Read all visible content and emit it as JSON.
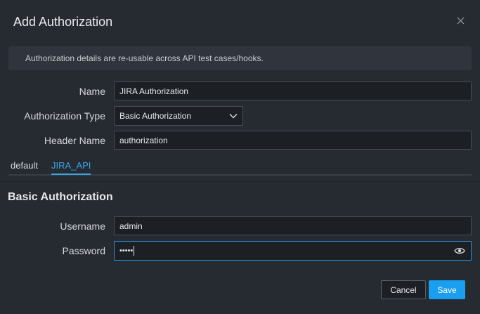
{
  "dialog": {
    "title": "Add Authorization",
    "close_icon": "close-icon",
    "info": "Authorization details are re-usable across API test cases/hooks."
  },
  "form": {
    "name_label": "Name",
    "name_value": "JIRA Authorization",
    "auth_type_label": "Authorization Type",
    "auth_type_value": "Basic Authorization",
    "header_name_label": "Header Name",
    "header_name_value": "authorization"
  },
  "tabs": [
    {
      "label": "default",
      "active": false
    },
    {
      "label": "JIRA_API",
      "active": true
    }
  ],
  "section": {
    "title": "Basic Authorization",
    "username_label": "Username",
    "username_value": "admin",
    "password_label": "Password",
    "password_masked": "•••••",
    "eye_icon": "eye-icon"
  },
  "actions": {
    "cancel_label": "Cancel",
    "save_label": "Save"
  },
  "colors": {
    "accent": "#1a9ef0",
    "tab_active": "#3aa6e8",
    "background": "#262a31"
  }
}
